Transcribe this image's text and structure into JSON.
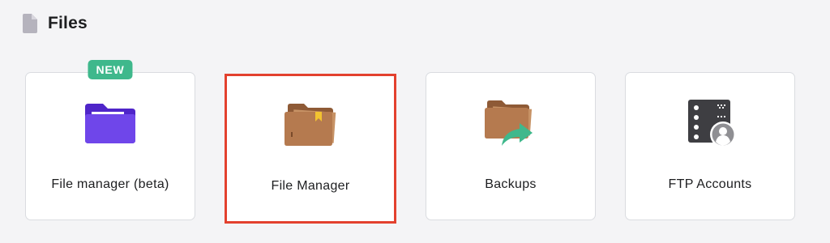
{
  "section": {
    "title": "Files",
    "icon": "document-icon"
  },
  "cards": [
    {
      "label": "File manager (beta)",
      "badge": "NEW",
      "icon": "purple-folder-icon",
      "color": "#673de6"
    },
    {
      "label": "File Manager",
      "icon": "brown-folder-bookmark-icon",
      "highlighted": true,
      "highlight_color": "#e3412e"
    },
    {
      "label": "Backups",
      "icon": "folder-restore-arrow-icon",
      "arrow_color": "#3fb88c"
    },
    {
      "label": "FTP Accounts",
      "icon": "server-user-icon"
    }
  ],
  "colors": {
    "background": "#f4f4f6",
    "badge": "#3fb88c",
    "folder_brown": "#b57a4f"
  }
}
